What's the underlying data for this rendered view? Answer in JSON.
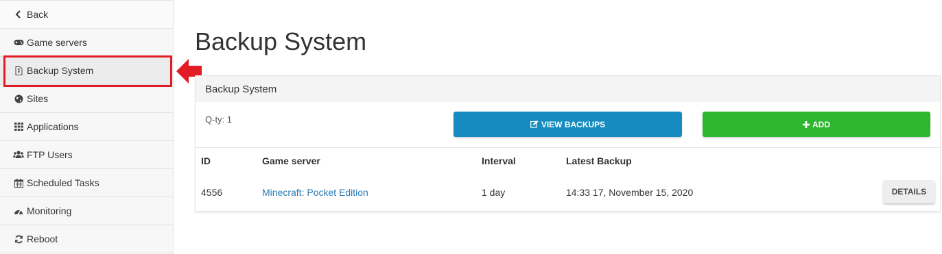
{
  "sidebar": {
    "items": [
      {
        "label": "Back",
        "icon": "chevron-left-icon"
      },
      {
        "label": "Game servers",
        "icon": "gamepad-icon"
      },
      {
        "label": "Backup System",
        "icon": "file-archive-icon"
      },
      {
        "label": "Sites",
        "icon": "globe-icon"
      },
      {
        "label": "Applications",
        "icon": "grid-icon"
      },
      {
        "label": "FTP Users",
        "icon": "users-icon"
      },
      {
        "label": "Scheduled Tasks",
        "icon": "calendar-icon"
      },
      {
        "label": "Monitoring",
        "icon": "dashboard-icon"
      },
      {
        "label": "Reboot",
        "icon": "refresh-icon"
      }
    ],
    "highlight_color": "#e21c24"
  },
  "page": {
    "title": "Backup System"
  },
  "panel": {
    "title": "Backup System",
    "qty_label": "Q-ty: 1",
    "view_backups_label": "VIEW BACKUPS",
    "add_label": "ADD",
    "view_color": "#168bc0",
    "add_color": "#2eb62e"
  },
  "table": {
    "headers": [
      "ID",
      "Game server",
      "Interval",
      "Latest Backup"
    ],
    "rows": [
      {
        "id": "4556",
        "game_server": "Minecraft: Pocket Edition",
        "interval": "1 day",
        "latest_backup": "14:33 17, November 15, 2020",
        "action": "DETAILS"
      }
    ]
  }
}
